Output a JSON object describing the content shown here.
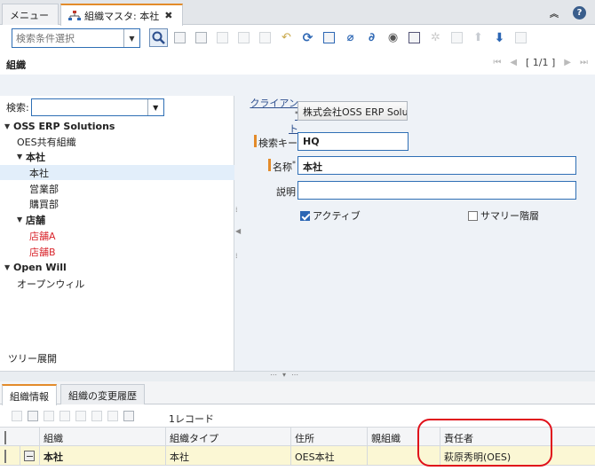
{
  "tabs": [
    {
      "label": "メニュー"
    },
    {
      "label": "組織マスタ: 本社",
      "close": "✖"
    }
  ],
  "toolbar": {
    "search_placeholder": "検索条件選択",
    "icons": [
      "search-icon",
      "new-record-icon",
      "copy-icon",
      "save-icon",
      "save-new-icon",
      "delete-icon",
      "undo-icon",
      "refresh-icon",
      "grid-toggle-icon",
      "attachment-icon",
      "chat-icon",
      "zoom-across-icon",
      "archive-icon",
      "process-icon",
      "print-icon",
      "previous-record-icon",
      "next-record-icon",
      "more-icon"
    ]
  },
  "header": {
    "section_label": "組織",
    "page_indicator": "[ 1/1 ]"
  },
  "tree": {
    "search_label": "検索:",
    "nodes": [
      {
        "label": "OSS ERP Solutions",
        "bold": true,
        "expand": "▼"
      },
      {
        "label": "OES共有組織"
      },
      {
        "label": "本社",
        "bold": true,
        "expand": "▼"
      },
      {
        "label": "本社",
        "selected": true
      },
      {
        "label": "営業部"
      },
      {
        "label": "購買部"
      },
      {
        "label": "店舗",
        "bold": true,
        "expand": "▼"
      },
      {
        "label": "店舗A",
        "red": true
      },
      {
        "label": "店舗B",
        "red": true
      },
      {
        "label": "Open Will",
        "bold": true,
        "expand": "▼"
      },
      {
        "label": "オープンウィル"
      }
    ],
    "footer": "ツリー展開"
  },
  "form": {
    "client_label_line1": "クライアン",
    "client_label_line2": "ト",
    "client_value": "株式会社OSS ERP Solu",
    "searchkey_label": "検索キー",
    "searchkey_value": "HQ",
    "name_label": "名称",
    "name_value": "本社",
    "description_label": "説明",
    "description_value": "",
    "active_label": "アクティブ",
    "summary_label": "サマリー階層",
    "required_mark": "*"
  },
  "bottom": {
    "tabs": [
      "組織情報",
      "組織の変更履歴"
    ],
    "record_count": "1レコード",
    "columns": [
      "組織",
      "組織タイプ",
      "住所",
      "親組織",
      "責任者"
    ],
    "rows": [
      [
        "本社",
        "本社",
        "OES本社",
        "",
        "萩原秀明(OES)"
      ]
    ]
  },
  "colors": {
    "accent": "#e38b2a",
    "selection": "#e2eefa",
    "row_highlight": "#fbf7d4",
    "annotation": "#e0101a",
    "link": "#2d4f8e"
  }
}
